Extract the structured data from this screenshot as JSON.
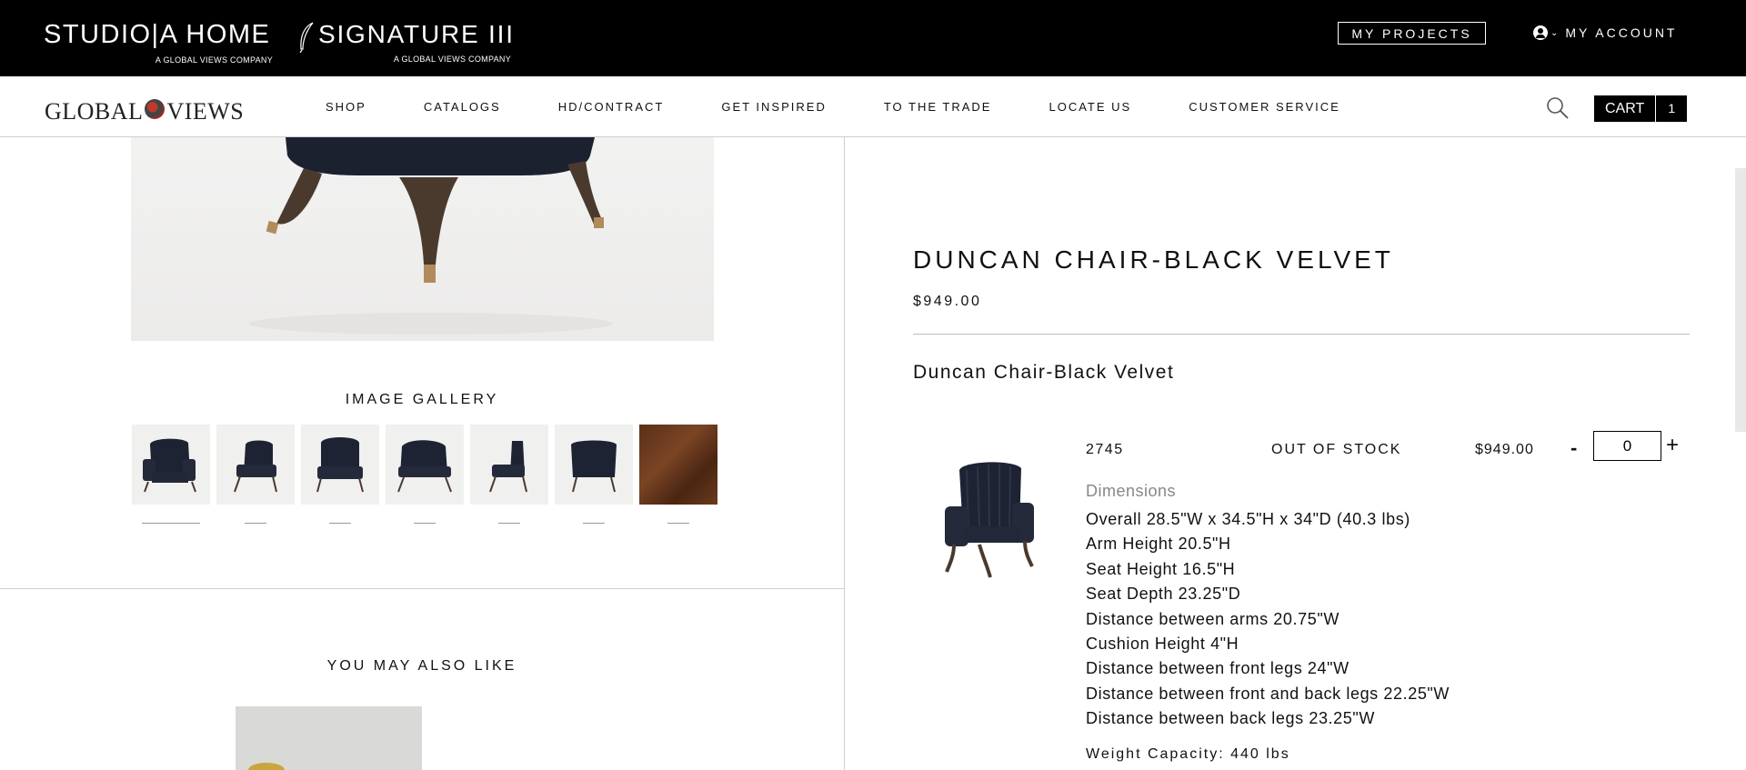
{
  "topbar": {
    "studio": {
      "name": "STUDIO|A   HOME",
      "sub": "A GLOBAL VIEWS COMPANY"
    },
    "signature": {
      "name": "SIGNATURE III",
      "sub": "A GLOBAL VIEWS COMPANY"
    },
    "my_projects": "MY PROJECTS",
    "my_account": "MY ACCOUNT"
  },
  "navbar": {
    "logo_left": "GLOBAL",
    "logo_right": "VIEWS",
    "items": [
      "SHOP",
      "CATALOGS",
      "HD/CONTRACT",
      "GET INSPIRED",
      "TO THE TRADE",
      "LOCATE US",
      "CUSTOMER SERVICE"
    ],
    "cart_label": "CART",
    "cart_count": "1"
  },
  "gallery": {
    "title": "IMAGE GALLERY",
    "thumbnail_count": 7
  },
  "also_like": {
    "title": "YOU MAY ALSO LIKE"
  },
  "product": {
    "title": "DUNCAN CHAIR-BLACK VELVET",
    "price": "$949.00",
    "subtitle": "Duncan Chair-Black Velvet",
    "variant": {
      "sku": "2745",
      "stock": "OUT OF STOCK",
      "price": "$949.00",
      "qty_minus": "-",
      "qty_value": "0",
      "qty_plus": "+"
    },
    "dimensions_label": "Dimensions",
    "dimensions": [
      "Overall 28.5\"W x 34.5\"H x 34\"D (40.3 lbs)",
      "Arm Height 20.5\"H",
      "Seat Height 16.5\"H",
      "Seat Depth 23.25\"D",
      "Distance between arms 20.75\"W",
      "Cushion Height 4\"H",
      "Distance between front legs 24\"W",
      "Distance between front and back legs 22.25\"W",
      "Distance between back legs 23.25\"W"
    ],
    "weight_capacity": "Weight Capacity: 440 lbs"
  },
  "colors": {
    "topbar_bg": "#000000",
    "accent": "#000000",
    "divider": "#cfcfcf",
    "dims_label": "#888888"
  },
  "icons": {
    "search": "search-icon",
    "user": "user-icon",
    "feather": "feather-icon",
    "globe": "globe-icon"
  }
}
